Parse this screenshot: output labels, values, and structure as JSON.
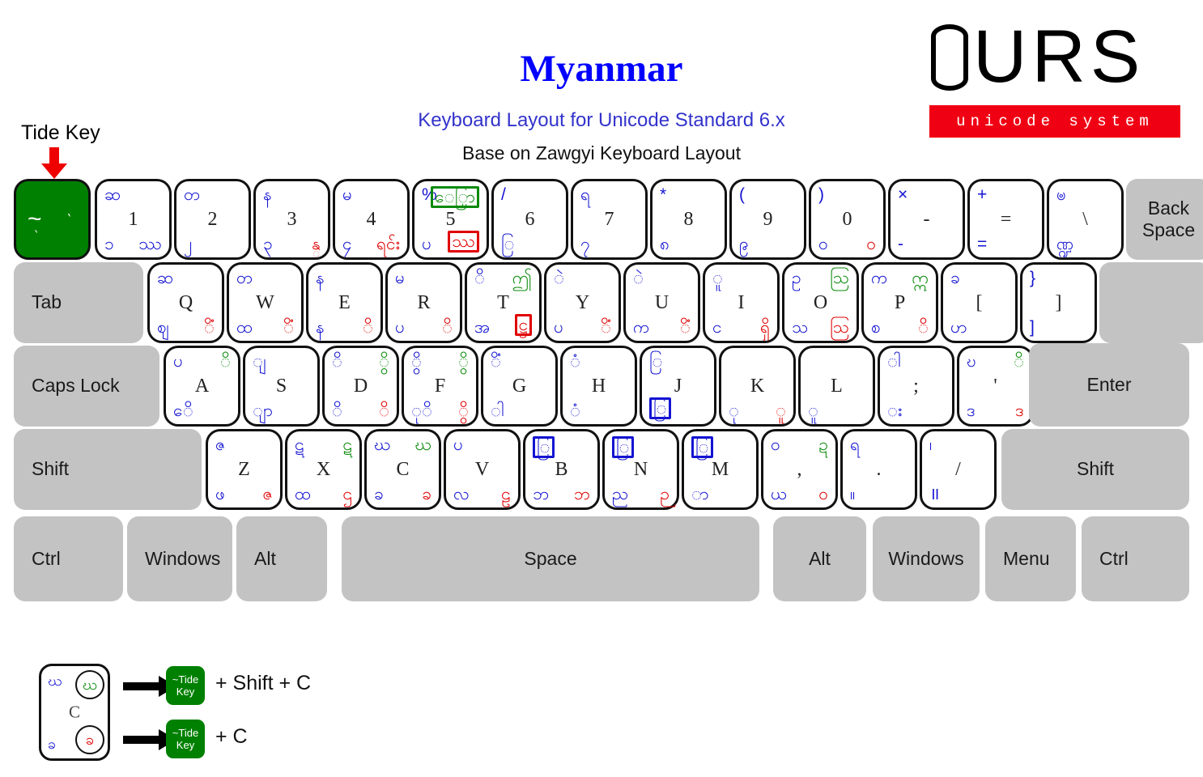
{
  "header": {
    "title": "Myanmar",
    "subtitle": "Keyboard Layout for Unicode Standard 6.x",
    "subtitle2": "Base on Zawgyi Keyboard Layout",
    "title_color": "#0000ff",
    "subtitle_color": "#3333cc"
  },
  "logo": {
    "letters": "URS",
    "tagline": "unicode system",
    "bar_color": "#f00013"
  },
  "annotation": {
    "tide_key_label": "Tide Key",
    "arrow_color": "#ee0000"
  },
  "tilde_key": {
    "name": "Tide Key",
    "fill": "#008000",
    "glyphs": [
      "~",
      "`",
      "`"
    ]
  },
  "colors": {
    "blue": "#1414d2",
    "red": "#e00000",
    "green": "#0a8a0a",
    "key_face": "#ffffff",
    "special_key": "#c3c3c3",
    "outline": "#111111"
  },
  "rows": {
    "number_row": [
      {
        "base": "1",
        "tl": "ဆ",
        "bl": "၁",
        "br": "ဿ",
        "tr": ""
      },
      {
        "base": "2",
        "tl": "တ",
        "bl": "၂",
        "br": "",
        "tr": ""
      },
      {
        "base": "3",
        "tl": "န",
        "bl": "၃",
        "br": "န္",
        "br_color": "red",
        "tr": ""
      },
      {
        "base": "4",
        "tl": "မ",
        "bl": "၄",
        "br": "ရင်း",
        "br_color": "red",
        "tr": ""
      },
      {
        "base": "5",
        "tl": "%",
        "tr": "ေြှာ",
        "tr_color": "green",
        "tr_boxed": true,
        "bl": "ပ",
        "br": "ဿ",
        "br_color": "red",
        "br_boxed": true
      },
      {
        "base": "6",
        "tl": "/",
        "bl": "ြ",
        "br": "",
        "tr": ""
      },
      {
        "base": "7",
        "tl": "ရ",
        "bl": "၇",
        "br": "",
        "tr": ""
      },
      {
        "base": "8",
        "tl": "*",
        "bl": "၈",
        "br": "",
        "tr": ""
      },
      {
        "base": "9",
        "tl": "(",
        "bl": "၉",
        "br": "",
        "tr": ""
      },
      {
        "base": "0",
        "tl": ")",
        "bl": "၀",
        "br": "ဝ",
        "br_color": "red",
        "tr": ""
      },
      {
        "base": "-",
        "tl": "×",
        "bl": "-",
        "br": "",
        "tr": ""
      },
      {
        "base": "=",
        "tl": "+",
        "bl": "=",
        "br": "",
        "tr": ""
      },
      {
        "base": "\\",
        "tl": "ၑ",
        "bl": "ဏ္ဍ",
        "br": "",
        "tr": ""
      }
    ],
    "top_row": [
      {
        "base": "Q",
        "tl": "ဆ",
        "bl": "ဈ",
        "br": "ိံ",
        "br_color": "red"
      },
      {
        "base": "W",
        "tl": "တ",
        "bl": "ထ",
        "br": "ိံ",
        "br_color": "red"
      },
      {
        "base": "E",
        "tl": "န",
        "bl": "န",
        "br": "ိ",
        "br_color": "red"
      },
      {
        "base": "R",
        "tl": "မ",
        "bl": "ပ",
        "br": "ိ",
        "br_color": "red"
      },
      {
        "base": "T",
        "tl": "ိ",
        "tr": "ဤ",
        "tr_color": "green",
        "bl": "အ",
        "br": "ဋ္ဌ",
        "br_color": "red",
        "br_boxed": true
      },
      {
        "base": "Y",
        "tl": "ဲ",
        "bl": "ပ",
        "br": "ိံ",
        "br_color": "red"
      },
      {
        "base": "U",
        "tl": "ဲ",
        "bl": "က",
        "br": "ိံ",
        "br_color": "red"
      },
      {
        "base": "I",
        "tl": "ူ",
        "bl": "င",
        "br": "ရှိ",
        "br_color": "red"
      },
      {
        "base": "O",
        "tl": "ဥ",
        "tr": "ဩ",
        "tr_color": "green",
        "bl": "သ",
        "br": "သြ",
        "br_color": "red"
      },
      {
        "base": "P",
        "tl": "က",
        "tr": "ဣ",
        "tr_color": "green",
        "bl": "စ",
        "br": "ိ",
        "br_color": "red"
      },
      {
        "base": "[",
        "tl": "ခ",
        "bl": "ဟ",
        "br": ""
      },
      {
        "base": "]",
        "tl": "}",
        "bl": "]",
        "br": ""
      }
    ],
    "home_row": [
      {
        "base": "A",
        "tl": "ပ",
        "tr": "ိ",
        "tr_color": "green",
        "bl": "ေိ",
        "br": ""
      },
      {
        "base": "S",
        "tl": "ျ",
        "bl": "ျာ",
        "br": ""
      },
      {
        "base": "D",
        "tl": "ိ",
        "tr": "ွိ",
        "tr_color": "green",
        "bl": "ိ",
        "br": "ိ",
        "br_color": "red"
      },
      {
        "base": "F",
        "tl": "ွိ",
        "tr": "ွိ",
        "tr_color": "green",
        "bl": "ုိ",
        "br": "ွိ",
        "br_color": "red"
      },
      {
        "base": "G",
        "tl": "ိံ",
        "bl": "ါ",
        "br": ""
      },
      {
        "base": "H",
        "tl": "ံ",
        "bl": "ံ",
        "br": ""
      },
      {
        "base": "J",
        "tl": "ြ",
        "bl": "ြ",
        "bl_boxed": true,
        "br": ""
      },
      {
        "base": "K",
        "tl": "",
        "bl": "ု",
        "br": "ူ",
        "br_color": "red"
      },
      {
        "base": "L",
        "tl": "",
        "bl": "ူ",
        "br": ""
      },
      {
        "base": ";",
        "tl": "ါ",
        "bl": "း",
        "br": ""
      },
      {
        "base": "'",
        "tl": "ဎ",
        "tr": "ိ",
        "tr_color": "green",
        "bl": "ဒ",
        "br": "ဒ",
        "br_color": "red"
      }
    ],
    "bottom_row": [
      {
        "base": "Z",
        "tl": "ဇ",
        "bl": "ဖ",
        "br": "ဇ",
        "br_color": "red"
      },
      {
        "base": "X",
        "tl": "ဋ",
        "tr": "ဋ",
        "tr_color": "green",
        "bl": "ထ",
        "br": "ဌ",
        "br_color": "red"
      },
      {
        "base": "C",
        "tl": "ဃ",
        "tr": "ဃ",
        "tr_color": "green",
        "bl": "ခ",
        "br": "ခ",
        "br_color": "red"
      },
      {
        "base": "V",
        "tl": "ပ",
        "bl": "လ",
        "br": "ဠ",
        "br_color": "red"
      },
      {
        "base": "B",
        "tl": "ြ",
        "tl_boxed": true,
        "bl": "ဘ",
        "br": "ဘ",
        "br_color": "red"
      },
      {
        "base": "N",
        "tl": "ြ",
        "tl_boxed": true,
        "bl": "ည",
        "br": "ဉ",
        "br_color": "red"
      },
      {
        "base": "M",
        "tl": "ြ",
        "tl_boxed": true,
        "bl": "ာ",
        "br": ""
      },
      {
        "base": ",",
        "tl": "ဝ",
        "tr": "ဍ",
        "tr_color": "green",
        "bl": "ယ",
        "br": "ဝ",
        "br_color": "red"
      },
      {
        "base": ".",
        "tl": "ရ",
        "bl": "။",
        "br": ""
      },
      {
        "base": "/",
        "tl": "၊",
        "bl": "॥",
        "br": ""
      }
    ]
  },
  "special_keys": {
    "backspace": "Back\nSpace",
    "backspace_line1": "Back",
    "backspace_line2": "Space",
    "tab": "Tab",
    "caps_lock": "Caps Lock",
    "enter": "Enter",
    "shift_left": "Shift",
    "shift_right": "Shift",
    "ctrl_left": "Ctrl",
    "ctrl_right": "Ctrl",
    "win_left": "Windows",
    "win_right": "Windows",
    "alt_left": "Alt",
    "alt_right": "Alt",
    "menu": "Menu",
    "space": "Space"
  },
  "legend": {
    "sample_key": {
      "base": "C",
      "tl": "ဃ",
      "tr": "ဃ",
      "bl": "ခ",
      "br": "ခ"
    },
    "tag_line1": "~Tide",
    "tag_line2": "Key",
    "combo_shift": "+ Shift + C",
    "combo_plain": "+ C",
    "tag_color": "#008000"
  }
}
